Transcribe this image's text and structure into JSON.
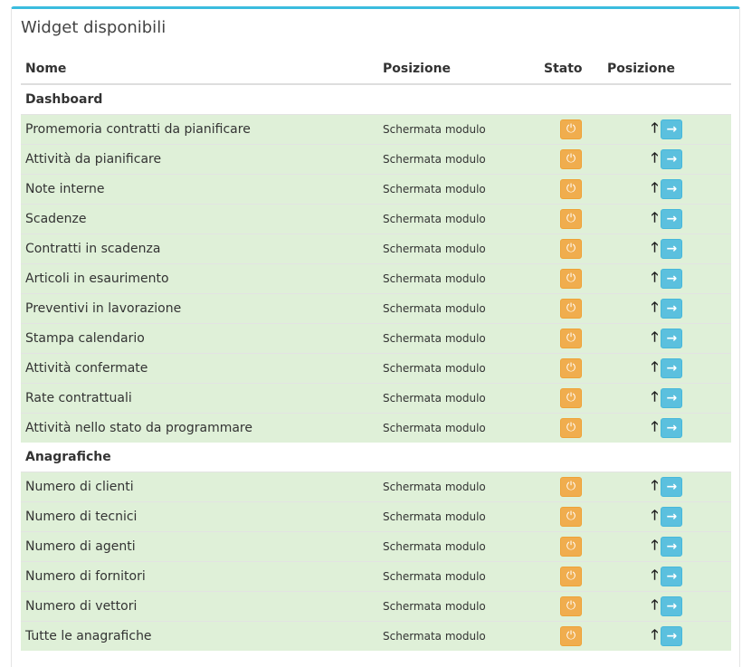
{
  "panel": {
    "title": "Widget disponibili"
  },
  "table": {
    "headers": {
      "name": "Nome",
      "position": "Posizione",
      "status": "Stato",
      "order": "Posizione"
    },
    "groups": [
      {
        "label": "Dashboard",
        "items": [
          {
            "name": "Promemoria contratti da pianificare",
            "position": "Schermata modulo"
          },
          {
            "name": "Attività da pianificare",
            "position": "Schermata modulo"
          },
          {
            "name": "Note interne",
            "position": "Schermata modulo"
          },
          {
            "name": "Scadenze",
            "position": "Schermata modulo"
          },
          {
            "name": "Contratti in scadenza",
            "position": "Schermata modulo"
          },
          {
            "name": "Articoli in esaurimento",
            "position": "Schermata modulo"
          },
          {
            "name": "Preventivi in lavorazione",
            "position": "Schermata modulo"
          },
          {
            "name": "Stampa calendario",
            "position": "Schermata modulo"
          },
          {
            "name": "Attività confermate",
            "position": "Schermata modulo"
          },
          {
            "name": "Rate contrattuali",
            "position": "Schermata modulo"
          },
          {
            "name": "Attività nello stato da programmare",
            "position": "Schermata modulo"
          }
        ]
      },
      {
        "label": "Anagrafiche",
        "items": [
          {
            "name": "Numero di clienti",
            "position": "Schermata modulo"
          },
          {
            "name": "Numero di tecnici",
            "position": "Schermata modulo"
          },
          {
            "name": "Numero di agenti",
            "position": "Schermata modulo"
          },
          {
            "name": "Numero di fornitori",
            "position": "Schermata modulo"
          },
          {
            "name": "Numero di vettori",
            "position": "Schermata modulo"
          },
          {
            "name": "Tutte le anagrafiche",
            "position": "Schermata modulo"
          }
        ]
      }
    ]
  },
  "icons": {
    "toggle": "power-icon",
    "move_up": "arrow-up-icon",
    "move_right": "arrow-right-icon"
  },
  "colors": {
    "accent": "#3bbcde",
    "row_bg": "#dff0d8",
    "warning": "#f0ad4e",
    "info": "#5bc0de"
  }
}
